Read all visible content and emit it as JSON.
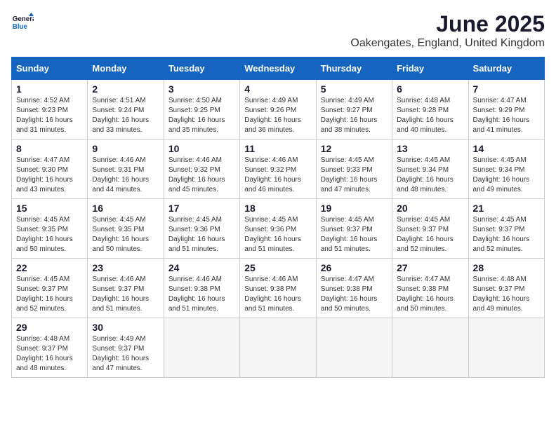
{
  "logo": {
    "line1": "General",
    "line2": "Blue"
  },
  "title": "June 2025",
  "location": "Oakengates, England, United Kingdom",
  "days_of_week": [
    "Sunday",
    "Monday",
    "Tuesday",
    "Wednesday",
    "Thursday",
    "Friday",
    "Saturday"
  ],
  "weeks": [
    [
      {
        "num": "1",
        "sunrise": "4:52 AM",
        "sunset": "9:23 PM",
        "daylight": "16 hours and 31 minutes."
      },
      {
        "num": "2",
        "sunrise": "4:51 AM",
        "sunset": "9:24 PM",
        "daylight": "16 hours and 33 minutes."
      },
      {
        "num": "3",
        "sunrise": "4:50 AM",
        "sunset": "9:25 PM",
        "daylight": "16 hours and 35 minutes."
      },
      {
        "num": "4",
        "sunrise": "4:49 AM",
        "sunset": "9:26 PM",
        "daylight": "16 hours and 36 minutes."
      },
      {
        "num": "5",
        "sunrise": "4:49 AM",
        "sunset": "9:27 PM",
        "daylight": "16 hours and 38 minutes."
      },
      {
        "num": "6",
        "sunrise": "4:48 AM",
        "sunset": "9:28 PM",
        "daylight": "16 hours and 40 minutes."
      },
      {
        "num": "7",
        "sunrise": "4:47 AM",
        "sunset": "9:29 PM",
        "daylight": "16 hours and 41 minutes."
      }
    ],
    [
      {
        "num": "8",
        "sunrise": "4:47 AM",
        "sunset": "9:30 PM",
        "daylight": "16 hours and 43 minutes."
      },
      {
        "num": "9",
        "sunrise": "4:46 AM",
        "sunset": "9:31 PM",
        "daylight": "16 hours and 44 minutes."
      },
      {
        "num": "10",
        "sunrise": "4:46 AM",
        "sunset": "9:32 PM",
        "daylight": "16 hours and 45 minutes."
      },
      {
        "num": "11",
        "sunrise": "4:46 AM",
        "sunset": "9:32 PM",
        "daylight": "16 hours and 46 minutes."
      },
      {
        "num": "12",
        "sunrise": "4:45 AM",
        "sunset": "9:33 PM",
        "daylight": "16 hours and 47 minutes."
      },
      {
        "num": "13",
        "sunrise": "4:45 AM",
        "sunset": "9:34 PM",
        "daylight": "16 hours and 48 minutes."
      },
      {
        "num": "14",
        "sunrise": "4:45 AM",
        "sunset": "9:34 PM",
        "daylight": "16 hours and 49 minutes."
      }
    ],
    [
      {
        "num": "15",
        "sunrise": "4:45 AM",
        "sunset": "9:35 PM",
        "daylight": "16 hours and 50 minutes."
      },
      {
        "num": "16",
        "sunrise": "4:45 AM",
        "sunset": "9:35 PM",
        "daylight": "16 hours and 50 minutes."
      },
      {
        "num": "17",
        "sunrise": "4:45 AM",
        "sunset": "9:36 PM",
        "daylight": "16 hours and 51 minutes."
      },
      {
        "num": "18",
        "sunrise": "4:45 AM",
        "sunset": "9:36 PM",
        "daylight": "16 hours and 51 minutes."
      },
      {
        "num": "19",
        "sunrise": "4:45 AM",
        "sunset": "9:37 PM",
        "daylight": "16 hours and 51 minutes."
      },
      {
        "num": "20",
        "sunrise": "4:45 AM",
        "sunset": "9:37 PM",
        "daylight": "16 hours and 52 minutes."
      },
      {
        "num": "21",
        "sunrise": "4:45 AM",
        "sunset": "9:37 PM",
        "daylight": "16 hours and 52 minutes."
      }
    ],
    [
      {
        "num": "22",
        "sunrise": "4:45 AM",
        "sunset": "9:37 PM",
        "daylight": "16 hours and 52 minutes."
      },
      {
        "num": "23",
        "sunrise": "4:46 AM",
        "sunset": "9:37 PM",
        "daylight": "16 hours and 51 minutes."
      },
      {
        "num": "24",
        "sunrise": "4:46 AM",
        "sunset": "9:38 PM",
        "daylight": "16 hours and 51 minutes."
      },
      {
        "num": "25",
        "sunrise": "4:46 AM",
        "sunset": "9:38 PM",
        "daylight": "16 hours and 51 minutes."
      },
      {
        "num": "26",
        "sunrise": "4:47 AM",
        "sunset": "9:38 PM",
        "daylight": "16 hours and 50 minutes."
      },
      {
        "num": "27",
        "sunrise": "4:47 AM",
        "sunset": "9:38 PM",
        "daylight": "16 hours and 50 minutes."
      },
      {
        "num": "28",
        "sunrise": "4:48 AM",
        "sunset": "9:37 PM",
        "daylight": "16 hours and 49 minutes."
      }
    ],
    [
      {
        "num": "29",
        "sunrise": "4:48 AM",
        "sunset": "9:37 PM",
        "daylight": "16 hours and 48 minutes."
      },
      {
        "num": "30",
        "sunrise": "4:49 AM",
        "sunset": "9:37 PM",
        "daylight": "16 hours and 47 minutes."
      },
      null,
      null,
      null,
      null,
      null
    ]
  ]
}
